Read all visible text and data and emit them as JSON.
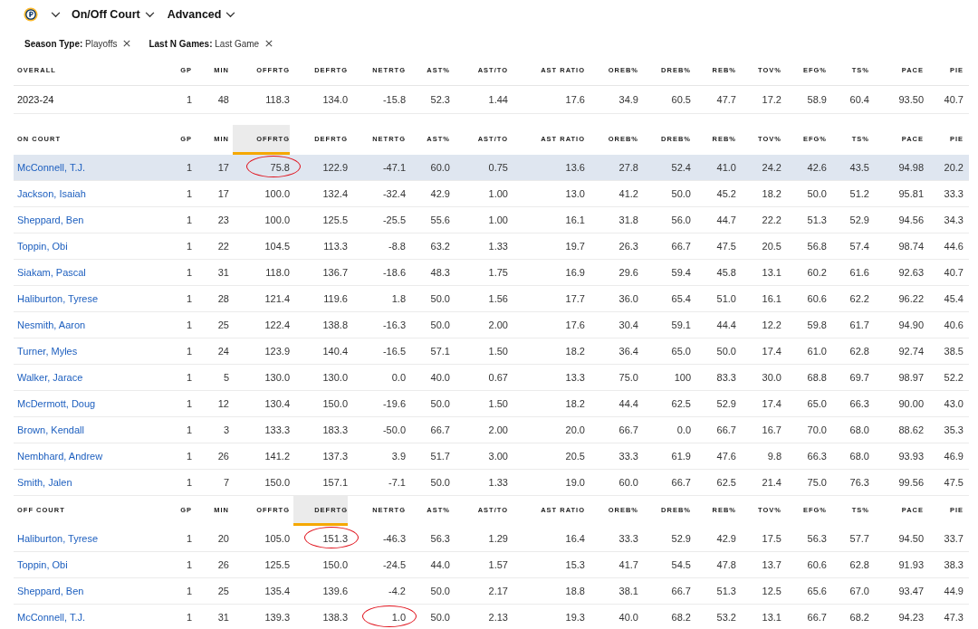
{
  "toolbar": {
    "menus": [
      {
        "label": "On/Off Court"
      },
      {
        "label": "Advanced"
      }
    ]
  },
  "filters": [
    {
      "name": "Season Type:",
      "value": "Playoffs"
    },
    {
      "name": "Last N Games:",
      "value": "Last Game"
    }
  ],
  "tables": [
    {
      "title": "OVERALL",
      "columns": [
        {
          "label": "GP",
          "selected": false
        },
        {
          "label": "MIN",
          "selected": false
        },
        {
          "label": "OFFRTG",
          "selected": false
        },
        {
          "label": "DEFRTG",
          "selected": false
        },
        {
          "label": "NETRTG",
          "selected": false
        },
        {
          "label": "AST%",
          "selected": false
        },
        {
          "label": "AST/TO",
          "selected": false
        },
        {
          "label": "AST RATIO",
          "selected": false
        },
        {
          "label": "OREB%",
          "selected": false
        },
        {
          "label": "DREB%",
          "selected": false
        },
        {
          "label": "REB%",
          "selected": false
        },
        {
          "label": "TOV%",
          "selected": false
        },
        {
          "label": "EFG%",
          "selected": false
        },
        {
          "label": "TS%",
          "selected": false
        },
        {
          "label": "PACE",
          "selected": false
        },
        {
          "label": "PIE",
          "selected": false
        }
      ],
      "rows": [
        {
          "name": "2023-24",
          "kind": "season",
          "selected": false,
          "values": [
            "1",
            "48",
            "118.3",
            "134.0",
            "-15.8",
            "52.3",
            "1.44",
            "17.6",
            "34.9",
            "60.5",
            "47.7",
            "17.2",
            "58.9",
            "60.4",
            "93.50",
            "40.7"
          ],
          "circled": [
            false,
            false,
            false,
            false,
            false,
            false,
            false,
            false,
            false,
            false,
            false,
            false,
            false,
            false,
            false,
            false
          ]
        }
      ]
    },
    {
      "title": "ON COURT",
      "columns": [
        {
          "label": "GP",
          "selected": false
        },
        {
          "label": "MIN",
          "selected": false
        },
        {
          "label": "OFFRTG",
          "selected": true
        },
        {
          "label": "DEFRTG",
          "selected": false
        },
        {
          "label": "NETRTG",
          "selected": false
        },
        {
          "label": "AST%",
          "selected": false
        },
        {
          "label": "AST/TO",
          "selected": false
        },
        {
          "label": "AST RATIO",
          "selected": false
        },
        {
          "label": "OREB%",
          "selected": false
        },
        {
          "label": "DREB%",
          "selected": false
        },
        {
          "label": "REB%",
          "selected": false
        },
        {
          "label": "TOV%",
          "selected": false
        },
        {
          "label": "EFG%",
          "selected": false
        },
        {
          "label": "TS%",
          "selected": false
        },
        {
          "label": "PACE",
          "selected": false
        },
        {
          "label": "PIE",
          "selected": false
        }
      ],
      "rows": [
        {
          "name": "McConnell, T.J.",
          "kind": "player",
          "selected": true,
          "values": [
            "1",
            "17",
            "75.8",
            "122.9",
            "-47.1",
            "60.0",
            "0.75",
            "13.6",
            "27.8",
            "52.4",
            "41.0",
            "24.2",
            "42.6",
            "43.5",
            "94.98",
            "20.2"
          ],
          "circled": [
            false,
            false,
            true,
            false,
            false,
            false,
            false,
            false,
            false,
            false,
            false,
            false,
            false,
            false,
            false,
            false
          ]
        },
        {
          "name": "Jackson, Isaiah",
          "kind": "player",
          "selected": false,
          "values": [
            "1",
            "17",
            "100.0",
            "132.4",
            "-32.4",
            "42.9",
            "1.00",
            "13.0",
            "41.2",
            "50.0",
            "45.2",
            "18.2",
            "50.0",
            "51.2",
            "95.81",
            "33.3"
          ],
          "circled": [
            false,
            false,
            false,
            false,
            false,
            false,
            false,
            false,
            false,
            false,
            false,
            false,
            false,
            false,
            false,
            false
          ]
        },
        {
          "name": "Sheppard, Ben",
          "kind": "player",
          "selected": false,
          "values": [
            "1",
            "23",
            "100.0",
            "125.5",
            "-25.5",
            "55.6",
            "1.00",
            "16.1",
            "31.8",
            "56.0",
            "44.7",
            "22.2",
            "51.3",
            "52.9",
            "94.56",
            "34.3"
          ],
          "circled": [
            false,
            false,
            false,
            false,
            false,
            false,
            false,
            false,
            false,
            false,
            false,
            false,
            false,
            false,
            false,
            false
          ]
        },
        {
          "name": "Toppin, Obi",
          "kind": "player",
          "selected": false,
          "values": [
            "1",
            "22",
            "104.5",
            "113.3",
            "-8.8",
            "63.2",
            "1.33",
            "19.7",
            "26.3",
            "66.7",
            "47.5",
            "20.5",
            "56.8",
            "57.4",
            "98.74",
            "44.6"
          ],
          "circled": [
            false,
            false,
            false,
            false,
            false,
            false,
            false,
            false,
            false,
            false,
            false,
            false,
            false,
            false,
            false,
            false
          ]
        },
        {
          "name": "Siakam, Pascal",
          "kind": "player",
          "selected": false,
          "values": [
            "1",
            "31",
            "118.0",
            "136.7",
            "-18.6",
            "48.3",
            "1.75",
            "16.9",
            "29.6",
            "59.4",
            "45.8",
            "13.1",
            "60.2",
            "61.6",
            "92.63",
            "40.7"
          ],
          "circled": [
            false,
            false,
            false,
            false,
            false,
            false,
            false,
            false,
            false,
            false,
            false,
            false,
            false,
            false,
            false,
            false
          ]
        },
        {
          "name": "Haliburton, Tyrese",
          "kind": "player",
          "selected": false,
          "values": [
            "1",
            "28",
            "121.4",
            "119.6",
            "1.8",
            "50.0",
            "1.56",
            "17.7",
            "36.0",
            "65.4",
            "51.0",
            "16.1",
            "60.6",
            "62.2",
            "96.22",
            "45.4"
          ],
          "circled": [
            false,
            false,
            false,
            false,
            false,
            false,
            false,
            false,
            false,
            false,
            false,
            false,
            false,
            false,
            false,
            false
          ]
        },
        {
          "name": "Nesmith, Aaron",
          "kind": "player",
          "selected": false,
          "values": [
            "1",
            "25",
            "122.4",
            "138.8",
            "-16.3",
            "50.0",
            "2.00",
            "17.6",
            "30.4",
            "59.1",
            "44.4",
            "12.2",
            "59.8",
            "61.7",
            "94.90",
            "40.6"
          ],
          "circled": [
            false,
            false,
            false,
            false,
            false,
            false,
            false,
            false,
            false,
            false,
            false,
            false,
            false,
            false,
            false,
            false
          ]
        },
        {
          "name": "Turner, Myles",
          "kind": "player",
          "selected": false,
          "values": [
            "1",
            "24",
            "123.9",
            "140.4",
            "-16.5",
            "57.1",
            "1.50",
            "18.2",
            "36.4",
            "65.0",
            "50.0",
            "17.4",
            "61.0",
            "62.8",
            "92.74",
            "38.5"
          ],
          "circled": [
            false,
            false,
            false,
            false,
            false,
            false,
            false,
            false,
            false,
            false,
            false,
            false,
            false,
            false,
            false,
            false
          ]
        },
        {
          "name": "Walker, Jarace",
          "kind": "player",
          "selected": false,
          "values": [
            "1",
            "5",
            "130.0",
            "130.0",
            "0.0",
            "40.0",
            "0.67",
            "13.3",
            "75.0",
            "100",
            "83.3",
            "30.0",
            "68.8",
            "69.7",
            "98.97",
            "52.2"
          ],
          "circled": [
            false,
            false,
            false,
            false,
            false,
            false,
            false,
            false,
            false,
            false,
            false,
            false,
            false,
            false,
            false,
            false
          ]
        },
        {
          "name": "McDermott, Doug",
          "kind": "player",
          "selected": false,
          "values": [
            "1",
            "12",
            "130.4",
            "150.0",
            "-19.6",
            "50.0",
            "1.50",
            "18.2",
            "44.4",
            "62.5",
            "52.9",
            "17.4",
            "65.0",
            "66.3",
            "90.00",
            "43.0"
          ],
          "circled": [
            false,
            false,
            false,
            false,
            false,
            false,
            false,
            false,
            false,
            false,
            false,
            false,
            false,
            false,
            false,
            false
          ]
        },
        {
          "name": "Brown, Kendall",
          "kind": "player",
          "selected": false,
          "values": [
            "1",
            "3",
            "133.3",
            "183.3",
            "-50.0",
            "66.7",
            "2.00",
            "20.0",
            "66.7",
            "0.0",
            "66.7",
            "16.7",
            "70.0",
            "68.0",
            "88.62",
            "35.3"
          ],
          "circled": [
            false,
            false,
            false,
            false,
            false,
            false,
            false,
            false,
            false,
            false,
            false,
            false,
            false,
            false,
            false,
            false
          ]
        },
        {
          "name": "Nembhard, Andrew",
          "kind": "player",
          "selected": false,
          "values": [
            "1",
            "26",
            "141.2",
            "137.3",
            "3.9",
            "51.7",
            "3.00",
            "20.5",
            "33.3",
            "61.9",
            "47.6",
            "9.8",
            "66.3",
            "68.0",
            "93.93",
            "46.9"
          ],
          "circled": [
            false,
            false,
            false,
            false,
            false,
            false,
            false,
            false,
            false,
            false,
            false,
            false,
            false,
            false,
            false,
            false
          ]
        },
        {
          "name": "Smith, Jalen",
          "kind": "player",
          "selected": false,
          "values": [
            "1",
            "7",
            "150.0",
            "157.1",
            "-7.1",
            "50.0",
            "1.33",
            "19.0",
            "60.0",
            "66.7",
            "62.5",
            "21.4",
            "75.0",
            "76.3",
            "99.56",
            "47.5"
          ],
          "circled": [
            false,
            false,
            false,
            false,
            false,
            false,
            false,
            false,
            false,
            false,
            false,
            false,
            false,
            false,
            false,
            false
          ]
        }
      ]
    },
    {
      "title": "OFF COURT",
      "columns": [
        {
          "label": "GP",
          "selected": false
        },
        {
          "label": "MIN",
          "selected": false
        },
        {
          "label": "OFFRTG",
          "selected": false
        },
        {
          "label": "DEFRTG",
          "selected": true
        },
        {
          "label": "NETRTG",
          "selected": false
        },
        {
          "label": "AST%",
          "selected": false
        },
        {
          "label": "AST/TO",
          "selected": false
        },
        {
          "label": "AST RATIO",
          "selected": false
        },
        {
          "label": "OREB%",
          "selected": false
        },
        {
          "label": "DREB%",
          "selected": false
        },
        {
          "label": "REB%",
          "selected": false
        },
        {
          "label": "TOV%",
          "selected": false
        },
        {
          "label": "EFG%",
          "selected": false
        },
        {
          "label": "TS%",
          "selected": false
        },
        {
          "label": "PACE",
          "selected": false
        },
        {
          "label": "PIE",
          "selected": false
        }
      ],
      "rows": [
        {
          "name": "Haliburton, Tyrese",
          "kind": "player",
          "selected": false,
          "values": [
            "1",
            "20",
            "105.0",
            "151.3",
            "-46.3",
            "56.3",
            "1.29",
            "16.4",
            "33.3",
            "52.9",
            "42.9",
            "17.5",
            "56.3",
            "57.7",
            "94.50",
            "33.7"
          ],
          "circled": [
            false,
            false,
            false,
            true,
            false,
            false,
            false,
            false,
            false,
            false,
            false,
            false,
            false,
            false,
            false,
            false
          ]
        },
        {
          "name": "Toppin, Obi",
          "kind": "player",
          "selected": false,
          "values": [
            "1",
            "26",
            "125.5",
            "150.0",
            "-24.5",
            "44.0",
            "1.57",
            "15.3",
            "41.7",
            "54.5",
            "47.8",
            "13.7",
            "60.6",
            "62.8",
            "91.93",
            "38.3"
          ],
          "circled": [
            false,
            false,
            false,
            false,
            false,
            false,
            false,
            false,
            false,
            false,
            false,
            false,
            false,
            false,
            false,
            false
          ]
        },
        {
          "name": "Sheppard, Ben",
          "kind": "player",
          "selected": false,
          "values": [
            "1",
            "25",
            "135.4",
            "139.6",
            "-4.2",
            "50.0",
            "2.17",
            "18.8",
            "38.1",
            "66.7",
            "51.3",
            "12.5",
            "65.6",
            "67.0",
            "93.47",
            "44.9"
          ],
          "circled": [
            false,
            false,
            false,
            false,
            false,
            false,
            false,
            false,
            false,
            false,
            false,
            false,
            false,
            false,
            false,
            false
          ]
        },
        {
          "name": "McConnell, T.J.",
          "kind": "player",
          "selected": false,
          "values": [
            "1",
            "31",
            "139.3",
            "138.3",
            "1.0",
            "50.0",
            "2.13",
            "19.3",
            "40.0",
            "68.2",
            "53.2",
            "13.1",
            "66.7",
            "68.2",
            "94.23",
            "47.3"
          ],
          "circled": [
            false,
            false,
            false,
            false,
            true,
            false,
            false,
            false,
            false,
            false,
            false,
            false,
            false,
            false,
            false,
            false
          ]
        }
      ]
    }
  ]
}
